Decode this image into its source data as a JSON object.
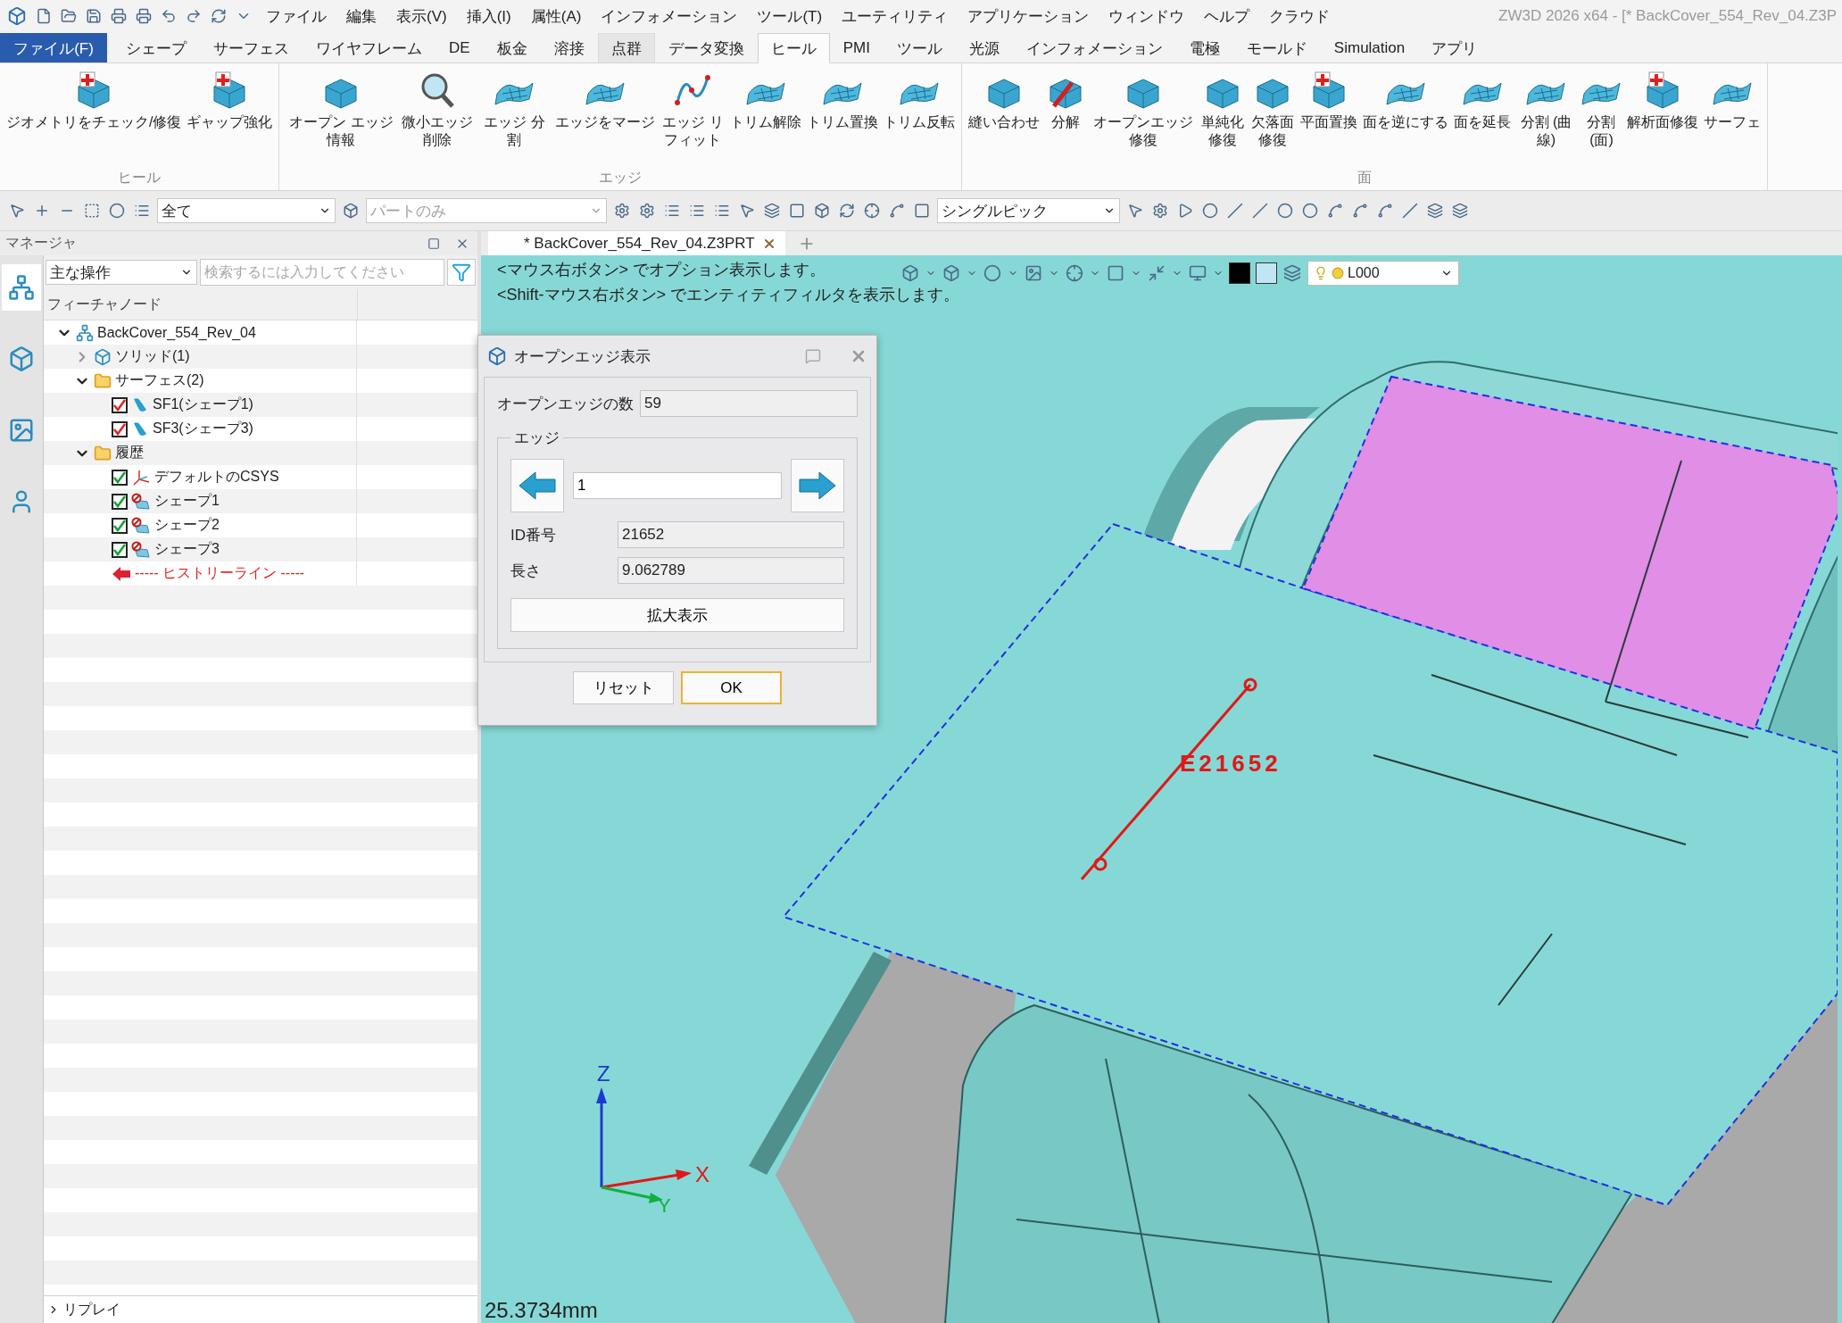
{
  "app_title": "ZW3D 2026 x64  - [* BackCover_554_Rev_04.Z3P",
  "menu": [
    "ファイル",
    "編集",
    "表示(V)",
    "挿入(I)",
    "属性(A)",
    "インフォメーション",
    "ツール(T)",
    "ユーティリティ",
    "アプリケーション",
    "ウィンドウ",
    "ヘルプ",
    "クラウド"
  ],
  "ribbon_tabs": [
    {
      "label": "ファイル(F)",
      "kind": "file",
      "selected": false
    },
    {
      "label": "シェープ",
      "kind": "tab",
      "selected": false
    },
    {
      "label": "サーフェス",
      "kind": "tab",
      "selected": false
    },
    {
      "label": "ワイヤフレーム",
      "kind": "tab",
      "selected": false
    },
    {
      "label": "DE",
      "kind": "tab",
      "selected": false
    },
    {
      "label": "板金",
      "kind": "tab",
      "selected": false
    },
    {
      "label": "溶接",
      "kind": "tab",
      "selected": false
    },
    {
      "label": "点群",
      "kind": "hover",
      "selected": false
    },
    {
      "label": "データ変換",
      "kind": "tab",
      "selected": false
    },
    {
      "label": "ヒール",
      "kind": "tab",
      "selected": true
    },
    {
      "label": "PMI",
      "kind": "tab",
      "selected": false
    },
    {
      "label": "ツール",
      "kind": "tab",
      "selected": false
    },
    {
      "label": "光源",
      "kind": "tab",
      "selected": false
    },
    {
      "label": "インフォメーション",
      "kind": "tab",
      "selected": false
    },
    {
      "label": "電極",
      "kind": "tab",
      "selected": false
    },
    {
      "label": "モールド",
      "kind": "tab",
      "selected": false
    },
    {
      "label": "Simulation",
      "kind": "tab",
      "selected": false
    },
    {
      "label": "アプリ",
      "kind": "tab",
      "selected": false
    }
  ],
  "ribbon_groups": [
    {
      "title": "ヒール",
      "buttons": [
        "ジオメトリをチェック/修復",
        "ギャップ強化"
      ]
    },
    {
      "title": "エッジ",
      "buttons": [
        "オープン エッジ情報",
        "微小エッジ削除",
        "エッジ 分割",
        "エッジをマージ",
        "エッジ リフィット",
        "トリム解除",
        "トリム置換",
        "トリム反転"
      ]
    },
    {
      "title": "面",
      "buttons": [
        "縫い合わせ",
        "分解",
        "オープンエッジ修復",
        "単純化修復",
        "欠落面修復",
        "平面置換",
        "面を逆にする",
        "面を延長",
        "分割 (曲線)",
        "分割 (面)",
        "解析面修復",
        "サーフェ"
      ]
    }
  ],
  "toolbar": {
    "combos": [
      {
        "value": "全て",
        "disabled": false
      },
      {
        "value": "パートのみ",
        "disabled": true
      },
      {
        "value": "シングルピック",
        "disabled": false
      }
    ]
  },
  "manager": {
    "title": "マネージャ",
    "side_tabs": [
      {
        "selected": true
      },
      {
        "selected": false
      },
      {
        "selected": false
      },
      {
        "selected": false
      }
    ],
    "mode": "主な操作",
    "search_placeholder": "検索するには入力してください",
    "column": "フィーチャノード",
    "tree": [
      {
        "label": "BackCover_554_Rev_04",
        "kind": "part",
        "expanded": true,
        "children": [
          {
            "label": "ソリッド(1)",
            "kind": "solid",
            "expanded": false
          },
          {
            "label": "サーフェス(2)",
            "kind": "folder",
            "expanded": true,
            "children": [
              {
                "label": "SF1(シェープ1)",
                "kind": "surface",
                "checked": true
              },
              {
                "label": "SF3(シェープ3)",
                "kind": "surface",
                "checked": true
              }
            ]
          },
          {
            "label": "履歴",
            "kind": "folder",
            "expanded": true,
            "children": [
              {
                "label": "デフォルトのCSYS",
                "kind": "csys",
                "checked": true
              },
              {
                "label": "シェープ1",
                "kind": "feature",
                "checked": true
              },
              {
                "label": "シェープ2",
                "kind": "feature",
                "checked": true
              },
              {
                "label": "シェープ3",
                "kind": "feature",
                "checked": true
              },
              {
                "label": "----- ヒストリーライン -----",
                "kind": "history_line"
              }
            ]
          }
        ]
      }
    ],
    "footer": "リプレイ"
  },
  "document_tab": {
    "label": "* BackCover_554_Rev_04.Z3PRT"
  },
  "viewport": {
    "hints": [
      "<マウス右ボタン> でオプション表示します。",
      "<Shift-マウス右ボタン> でエンティティフィルタを表示します。"
    ],
    "layer": "L000",
    "edge_label": "E21652",
    "axes": [
      "Z",
      "X",
      "Y"
    ],
    "scale": "25.3734mm"
  },
  "dialog": {
    "title": "オープンエッジ表示",
    "count_label": "オープンエッジの数",
    "count": "59",
    "group": "エッジ",
    "index": "1",
    "fields": [
      {
        "label": "ID番号",
        "value": "21652"
      },
      {
        "label": "長さ",
        "value": "9.062789"
      }
    ],
    "zoom_button": "拡大表示",
    "buttons": [
      {
        "label": "リセット",
        "default": false
      },
      {
        "label": "OK",
        "default": true
      }
    ]
  }
}
